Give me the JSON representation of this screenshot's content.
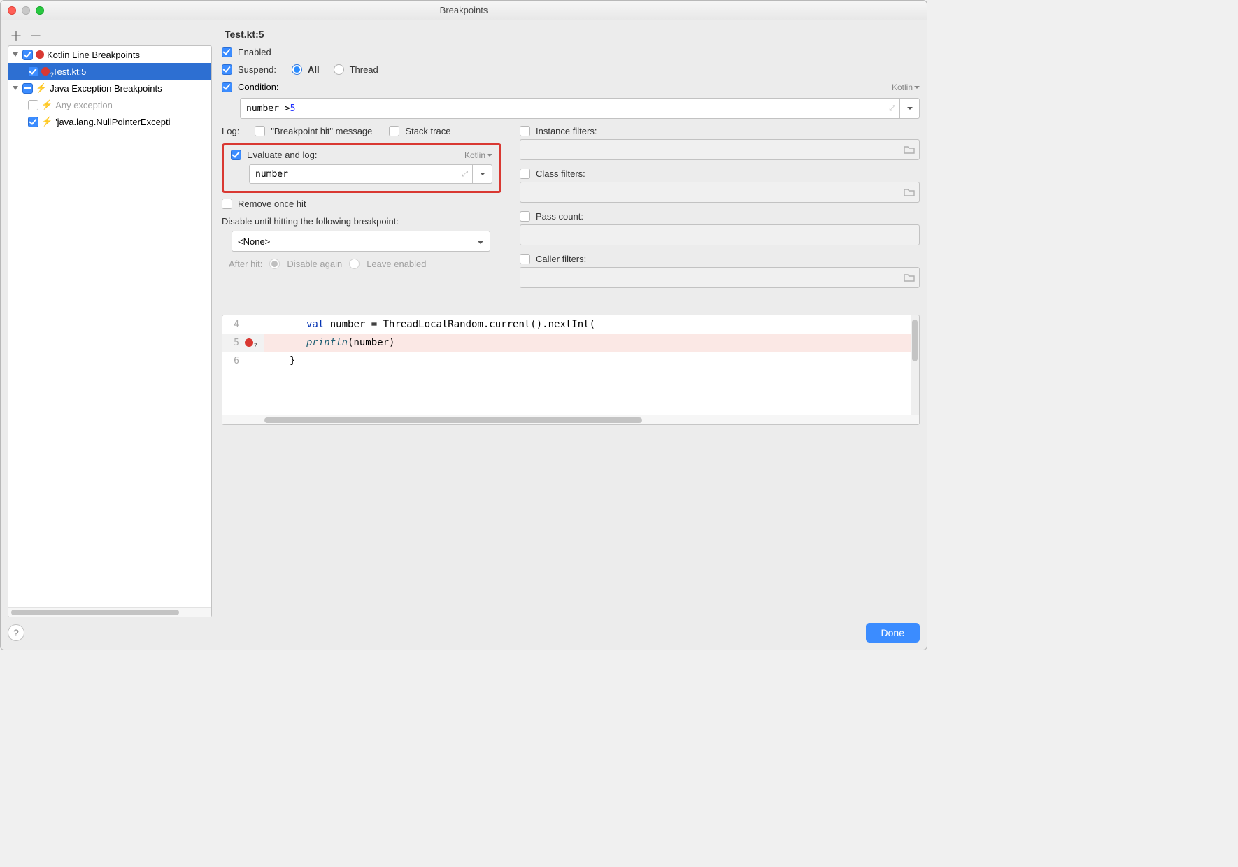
{
  "window": {
    "title": "Breakpoints"
  },
  "tree": {
    "group1": {
      "label": "Kotlin Line Breakpoints",
      "item": "Test.kt:5"
    },
    "group2": {
      "label": "Java Exception Breakpoints",
      "any": "Any exception",
      "npe": "'java.lang.NullPointerExcepti"
    }
  },
  "details": {
    "title": "Test.kt:5",
    "enabled": "Enabled",
    "suspend": "Suspend:",
    "all": "All",
    "thread": "Thread",
    "condition": "Condition:",
    "lang": "Kotlin",
    "condition_expr_prefix": "number > ",
    "condition_expr_num": "5",
    "log": "Log:",
    "hit_msg": "\"Breakpoint hit\" message",
    "stack": "Stack trace",
    "eval_log": "Evaluate and log:",
    "eval_expr": "number",
    "remove": "Remove once hit",
    "disable_until": "Disable until hitting the following breakpoint:",
    "none": "<None>",
    "after_hit": "After hit:",
    "disable_again": "Disable again",
    "leave_enabled": "Leave enabled",
    "filters": {
      "instance": "Instance filters:",
      "class": "Class filters:",
      "pass": "Pass count:",
      "caller": "Caller filters:"
    },
    "code": {
      "l4_kw": "val",
      "l4_rest": " number = ThreadLocalRandom.current().nextInt(",
      "l5_fn": "println",
      "l5_rest": "(number)",
      "l6": "}"
    }
  },
  "footer": {
    "done": "Done"
  }
}
